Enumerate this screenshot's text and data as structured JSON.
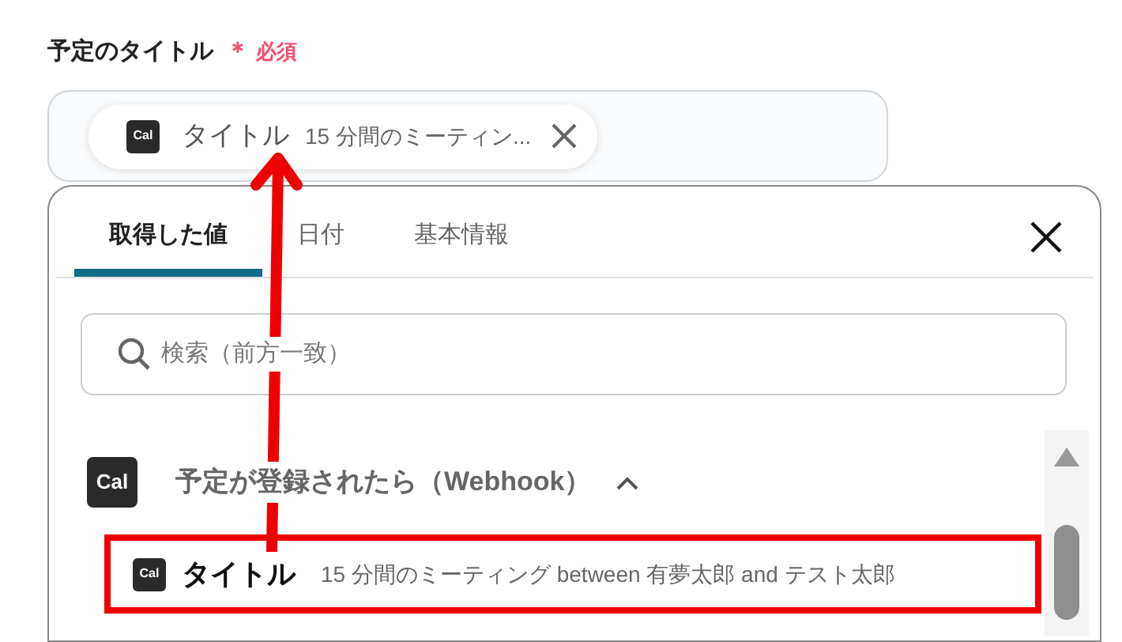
{
  "field": {
    "label": "予定のタイトル",
    "required_mark": "＊",
    "required_text": "必須",
    "chip": {
      "icon_text": "Cal",
      "name": "タイトル",
      "value": "15 分間のミーティン..."
    }
  },
  "picker": {
    "tabs": [
      {
        "label": "取得した値",
        "selected": true
      },
      {
        "label": "日付",
        "selected": false
      },
      {
        "label": "基本情報",
        "selected": false
      }
    ],
    "search": {
      "placeholder": "検索（前方一致）"
    },
    "group": {
      "icon_text": "Cal",
      "title": "予定が登録されたら（Webhook）",
      "expanded": true,
      "items": [
        {
          "icon_text": "Cal",
          "name": "タイトル",
          "value": "15 分間のミーティング between 有夢太郎 and テスト太郎",
          "highlighted": true
        }
      ]
    }
  }
}
